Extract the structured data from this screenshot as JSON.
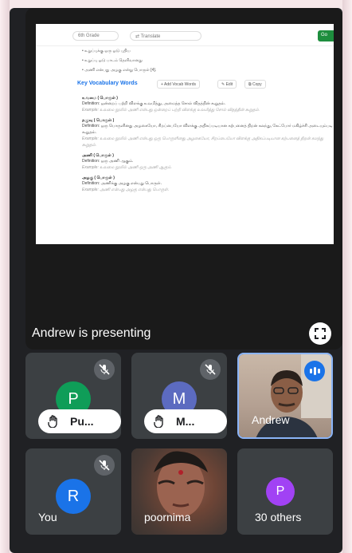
{
  "presentation": {
    "document": {
      "dropdown": "6th Grade",
      "translate": "Translate",
      "bullets": [
        "• உறுப்புக்கு ஒரு ஓடு புதிய",
        "• உறுப்பு ஓடு பாடம் தெளிவானது",
        "• அணி என்பது அழகு என்று பொருள் [4]."
      ],
      "section_title": "Key Vocabulary Words",
      "buttons": {
        "add": "Add Vocab Words",
        "edit": "Edit",
        "copy": "Copy"
      },
      "entries": [
        {
          "word": "உவமை ( பொருள் )",
          "definition": "Definition: ஒன்றைப் பற்றி விளக்கு உவமித்து, அமைத்த சொல் விதத்தின் கூறுதல்.",
          "example": "Example: உவமை நூலில் அணி என்பது ஒன்றைப் பற்றி விளக்கு உவமித்து சொல் விதத்தின் கூறுதல்."
        },
        {
          "word": "தழுவு ( பொருள் )",
          "definition": "Definition: ஒரு பொருளினது அழகையோ, சிறப்பையோ விளக்கு அதிகப்படியான கற்பனைத் திறன் கலந்து, கேட்போர் மகிழ்ச்சி அடையும்படி கூறுதல்.",
          "example": "Example: உவமை நூலில் அணி என்பது ஒரு பொருளினது அழகையோ, சிறப்பையோ விளக்கு அதிகப்படியான கற்பனைத் திறன் கலந்து கூறுதல்."
        },
        {
          "word": "அணி ( பொருள் )",
          "definition": "Definition: ஒரு அணி ஆகும்.",
          "example": "Example: உவமை நூலில் அணி ஒரு அணி ஆகும்."
        },
        {
          "word": "அழகு ( பொருள் )",
          "definition": "Definition: அணிக்கு அழகு என்பது பொருள்.",
          "example": "Example: அணி என்பது அழகு என்பது பொருள்."
        }
      ]
    },
    "presenting_label": "Andrew is presenting"
  },
  "participants": [
    {
      "initial": "P",
      "name": "Pu...",
      "muted": true,
      "hand_raised": true,
      "color": "#0f9d58"
    },
    {
      "initial": "M",
      "name": "M...",
      "muted": true,
      "hand_raised": true,
      "color": "#5c6bc0"
    },
    {
      "name": "Andrew",
      "muted": false,
      "speaking": true,
      "video": true
    },
    {
      "initial": "R",
      "name": "You",
      "muted": true,
      "color": "#1a73e8"
    },
    {
      "name": "poornima",
      "video": true
    },
    {
      "initial": "P",
      "name": "30 others",
      "color": "#a142f4"
    }
  ],
  "colors": {
    "accent": "#1a73e8",
    "tile_bg": "#3c4043",
    "page_bg": "#202124"
  }
}
